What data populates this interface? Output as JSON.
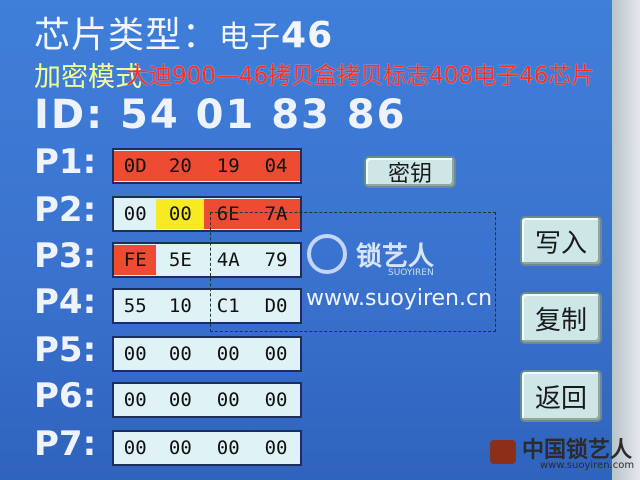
{
  "header": {
    "title_prefix": "芯片类型：",
    "chip_label": "电子",
    "chip_number": "46"
  },
  "mode_label": "加密模式",
  "overlay_caption": "大迪900—46拷贝盒拷贝标志408电子46芯片",
  "id_row": {
    "label": "ID:",
    "value": "54 01 83 86"
  },
  "pages": [
    {
      "label": "P1:",
      "bytes": [
        {
          "v": "0D",
          "c": "red"
        },
        {
          "v": "20",
          "c": "red"
        },
        {
          "v": "19",
          "c": "red"
        },
        {
          "v": "04",
          "c": "red"
        }
      ]
    },
    {
      "label": "P2:",
      "bytes": [
        {
          "v": "00",
          "c": ""
        },
        {
          "v": "00",
          "c": "yellow"
        },
        {
          "v": "6E",
          "c": "red"
        },
        {
          "v": "7A",
          "c": "red"
        }
      ]
    },
    {
      "label": "P3:",
      "bytes": [
        {
          "v": "FE",
          "c": "red"
        },
        {
          "v": "5E",
          "c": ""
        },
        {
          "v": "4A",
          "c": ""
        },
        {
          "v": "79",
          "c": ""
        }
      ]
    },
    {
      "label": "P4:",
      "bytes": [
        {
          "v": "55",
          "c": ""
        },
        {
          "v": "10",
          "c": ""
        },
        {
          "v": "C1",
          "c": ""
        },
        {
          "v": "D0",
          "c": ""
        }
      ]
    },
    {
      "label": "P5:",
      "bytes": [
        {
          "v": "00",
          "c": ""
        },
        {
          "v": "00",
          "c": ""
        },
        {
          "v": "00",
          "c": ""
        },
        {
          "v": "00",
          "c": ""
        }
      ]
    },
    {
      "label": "P6:",
      "bytes": [
        {
          "v": "00",
          "c": ""
        },
        {
          "v": "00",
          "c": ""
        },
        {
          "v": "00",
          "c": ""
        },
        {
          "v": "00",
          "c": ""
        }
      ]
    },
    {
      "label": "P7:",
      "bytes": [
        {
          "v": "00",
          "c": ""
        },
        {
          "v": "00",
          "c": ""
        },
        {
          "v": "00",
          "c": ""
        },
        {
          "v": "00",
          "c": ""
        }
      ]
    }
  ],
  "buttons": {
    "key": "密钥",
    "write": "写入",
    "copy": "复制",
    "back": "返回"
  },
  "watermark": {
    "logo": "锁艺人",
    "sub": "SUOYIREN",
    "url": "www.suoyiren.cn"
  },
  "corner_watermark": {
    "logo": "中国锁艺人",
    "url": "www.suoyiren.com"
  },
  "colors": {
    "screen": "#3a73cf",
    "cell_red": "#ee4b33",
    "cell_yellow": "#f7ea21",
    "cell_plain": "#dff3f6"
  }
}
